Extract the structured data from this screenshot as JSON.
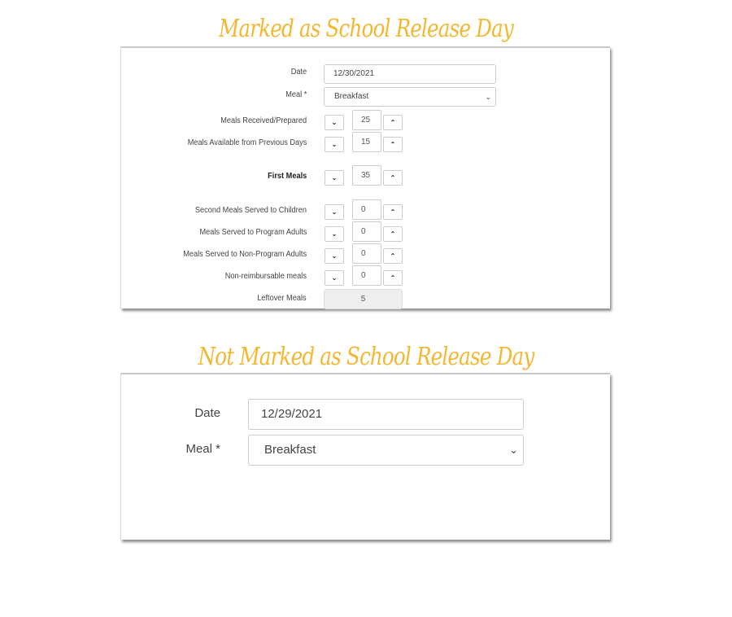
{
  "sections": [
    {
      "title": "Marked as School Release Day",
      "date": {
        "label": "Date",
        "value": "12/30/2021"
      },
      "meal": {
        "label": "Meal *",
        "value": "Breakfast"
      },
      "steppers": [
        {
          "label": "Meals Received/Prepared",
          "value": "25",
          "bold": false
        },
        {
          "label": "Meals Available from Previous Days",
          "value": "15",
          "bold": false
        },
        {
          "label": "First Meals",
          "value": "35",
          "bold": true
        },
        {
          "label": "Second Meals Served to Children",
          "value": "0",
          "bold": false
        },
        {
          "label": "Meals Served to Program Adults",
          "value": "0",
          "bold": false
        },
        {
          "label": "Meals Served to Non-Program Adults",
          "value": "0",
          "bold": false
        },
        {
          "label": "Non-reimbursable meals",
          "value": "0",
          "bold": false
        }
      ],
      "leftover": {
        "label": "Leftover Meals",
        "value": "5"
      }
    },
    {
      "title": "Not Marked as School Release Day",
      "date": {
        "label": "Date",
        "value": "12/29/2021"
      },
      "meal": {
        "label": "Meal *",
        "value": "Breakfast"
      }
    }
  ],
  "icons": {
    "decrement": "⌄",
    "increment": "⌃",
    "dropdown": "⌄"
  },
  "colors": {
    "title": "#f3b731",
    "readonly_bg": "#eeeeee",
    "border": "#cccccc"
  }
}
